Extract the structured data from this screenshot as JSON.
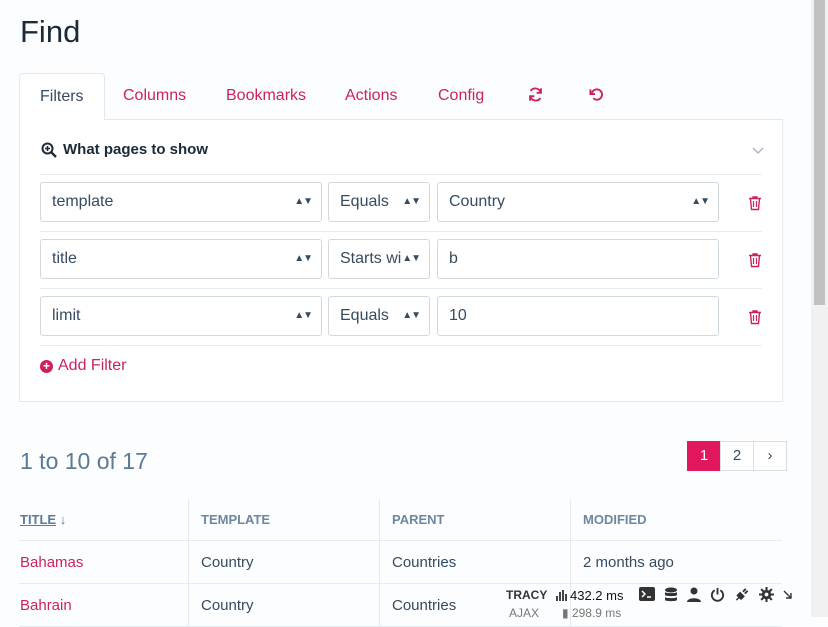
{
  "page_title": "Find",
  "tabs": [
    {
      "label": "Filters"
    },
    {
      "label": "Columns"
    },
    {
      "label": "Bookmarks"
    },
    {
      "label": "Actions"
    },
    {
      "label": "Config"
    }
  ],
  "tab_icons": [
    "refresh-icon",
    "reset-icon"
  ],
  "section": {
    "title": "What pages to show"
  },
  "filters": [
    {
      "field": "template",
      "operator": "Equals",
      "value": "Country"
    },
    {
      "field": "title",
      "operator": "Starts wi",
      "value": "b"
    },
    {
      "field": "limit",
      "operator": "Equals",
      "value": "10"
    }
  ],
  "add_filter_label": "Add Filter",
  "summary": "1 to 10 of 17",
  "pagination": {
    "pages": [
      "1",
      "2"
    ],
    "current": "1",
    "next": "›"
  },
  "table": {
    "headers": {
      "title": "TITLE",
      "title_sort": "↓",
      "template": "TEMPLATE",
      "parent": "PARENT",
      "modified": "MODIFIED"
    },
    "rows": [
      {
        "title": "Bahamas",
        "template": "Country",
        "parent": "Countries",
        "modified": "2 months ago"
      },
      {
        "title": "Bahrain",
        "template": "Country",
        "parent": "Countries",
        "modified": ""
      }
    ]
  },
  "tracy": {
    "label": "TRACY",
    "time": "432.2 ms",
    "ajax_label": "AJAX",
    "ajax_time": "298.9 ms"
  },
  "colors": {
    "accent": "#cb2264",
    "pager_active": "#e2185e"
  }
}
